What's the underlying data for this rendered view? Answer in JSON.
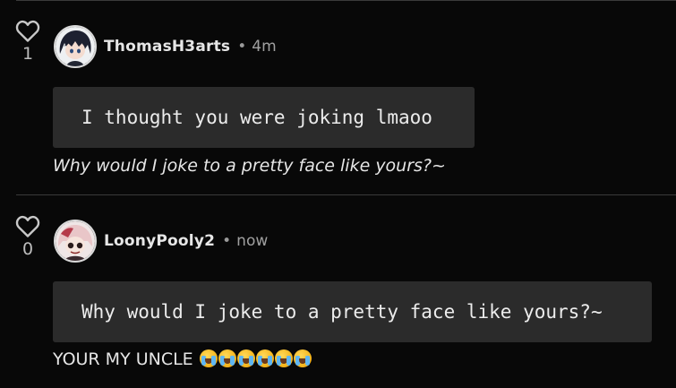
{
  "comments": [
    {
      "username": "ThomasH3arts",
      "separator": "•",
      "time": "4m",
      "likes": "1",
      "quote": "I thought you were joking lmaoo",
      "reply": "Why would I joke to a pretty face like yours?~"
    },
    {
      "username": "LoonyPooly2",
      "separator": "•",
      "time": "now",
      "likes": "0",
      "quote": "Why would I joke to a pretty face like yours?~",
      "reply": "YOUR MY UNCLE",
      "reply_emoji_count": 6,
      "reply_emoji": "loudly-crying-face-emoji"
    }
  ],
  "icons": {
    "like": "heart-icon"
  },
  "colors": {
    "background": "#080808",
    "quote_background": "#2b2b2b",
    "divider": "#3a3a3a",
    "text": "#e6e6e6",
    "muted": "#a0a0a0"
  }
}
